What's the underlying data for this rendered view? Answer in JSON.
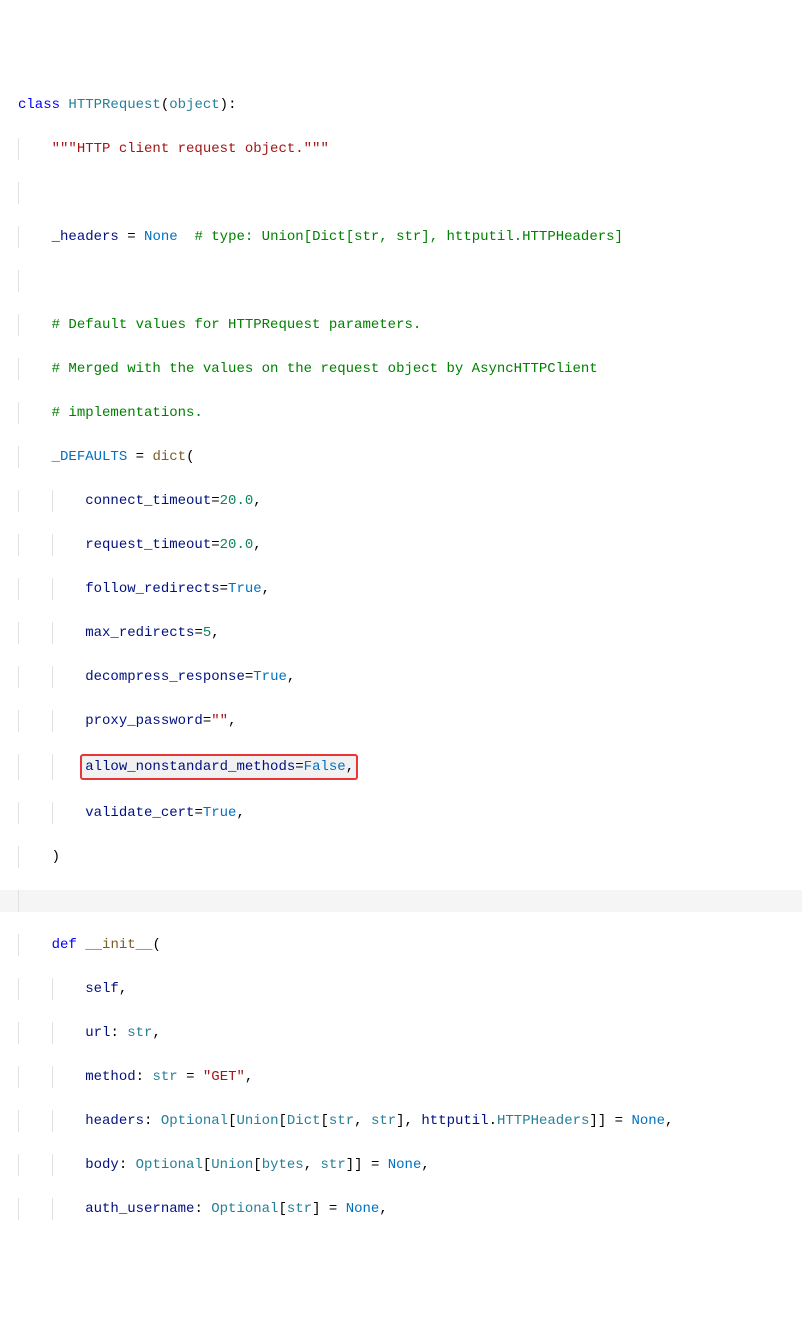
{
  "line1": {
    "kw_class": "class",
    "name": "HTTPRequest",
    "base": "object"
  },
  "line2": {
    "docstring": "\"\"\"HTTP client request object.\"\"\""
  },
  "line4": {
    "var": "_headers",
    "eq": " = ",
    "val": "None",
    "cmt": "# type: Union[Dict[str, str], httputil.HTTPHeaders]"
  },
  "line6": {
    "cmt": "# Default values for HTTPRequest parameters."
  },
  "line7": {
    "cmt": "# Merged with the values on the request object by AsyncHTTPClient"
  },
  "line8": {
    "cmt": "# implementations."
  },
  "line9": {
    "var": "_DEFAULTS",
    "eq": " = ",
    "func": "dict",
    "open": "("
  },
  "line10": {
    "param": "connect_timeout",
    "val": "20.0"
  },
  "line11": {
    "param": "request_timeout",
    "val": "20.0"
  },
  "line12": {
    "param": "follow_redirects",
    "val": "True"
  },
  "line13": {
    "param": "max_redirects",
    "val": "5"
  },
  "line14": {
    "param": "decompress_response",
    "val": "True"
  },
  "line15": {
    "param": "proxy_password",
    "val": "\"\""
  },
  "line16": {
    "param": "allow_nonstandard_methods",
    "val": "False"
  },
  "line17": {
    "param": "validate_cert",
    "val": "True"
  },
  "line18": {
    "close": ")"
  },
  "line20": {
    "kw_def": "def",
    "name": "__init__",
    "open": "("
  },
  "line21": {
    "param": "self"
  },
  "line22": {
    "param": "url",
    "type": "str"
  },
  "line23": {
    "param": "method",
    "type": "str",
    "default_str": "\"GET\""
  },
  "line24": {
    "param": "headers",
    "type_full": {
      "opt": "Optional",
      "un": "Union",
      "d": "Dict",
      "s1": "str",
      "s2": "str",
      "mod": "httputil",
      "cls": "HTTPHeaders"
    },
    "default": "None"
  },
  "line25": {
    "param": "body",
    "type_full": {
      "opt": "Optional",
      "un": "Union",
      "b": "bytes",
      "s": "str"
    },
    "default": "None"
  },
  "line26": {
    "param": "auth_username",
    "type_full": {
      "opt": "Optional",
      "s": "str"
    },
    "default": "None"
  }
}
